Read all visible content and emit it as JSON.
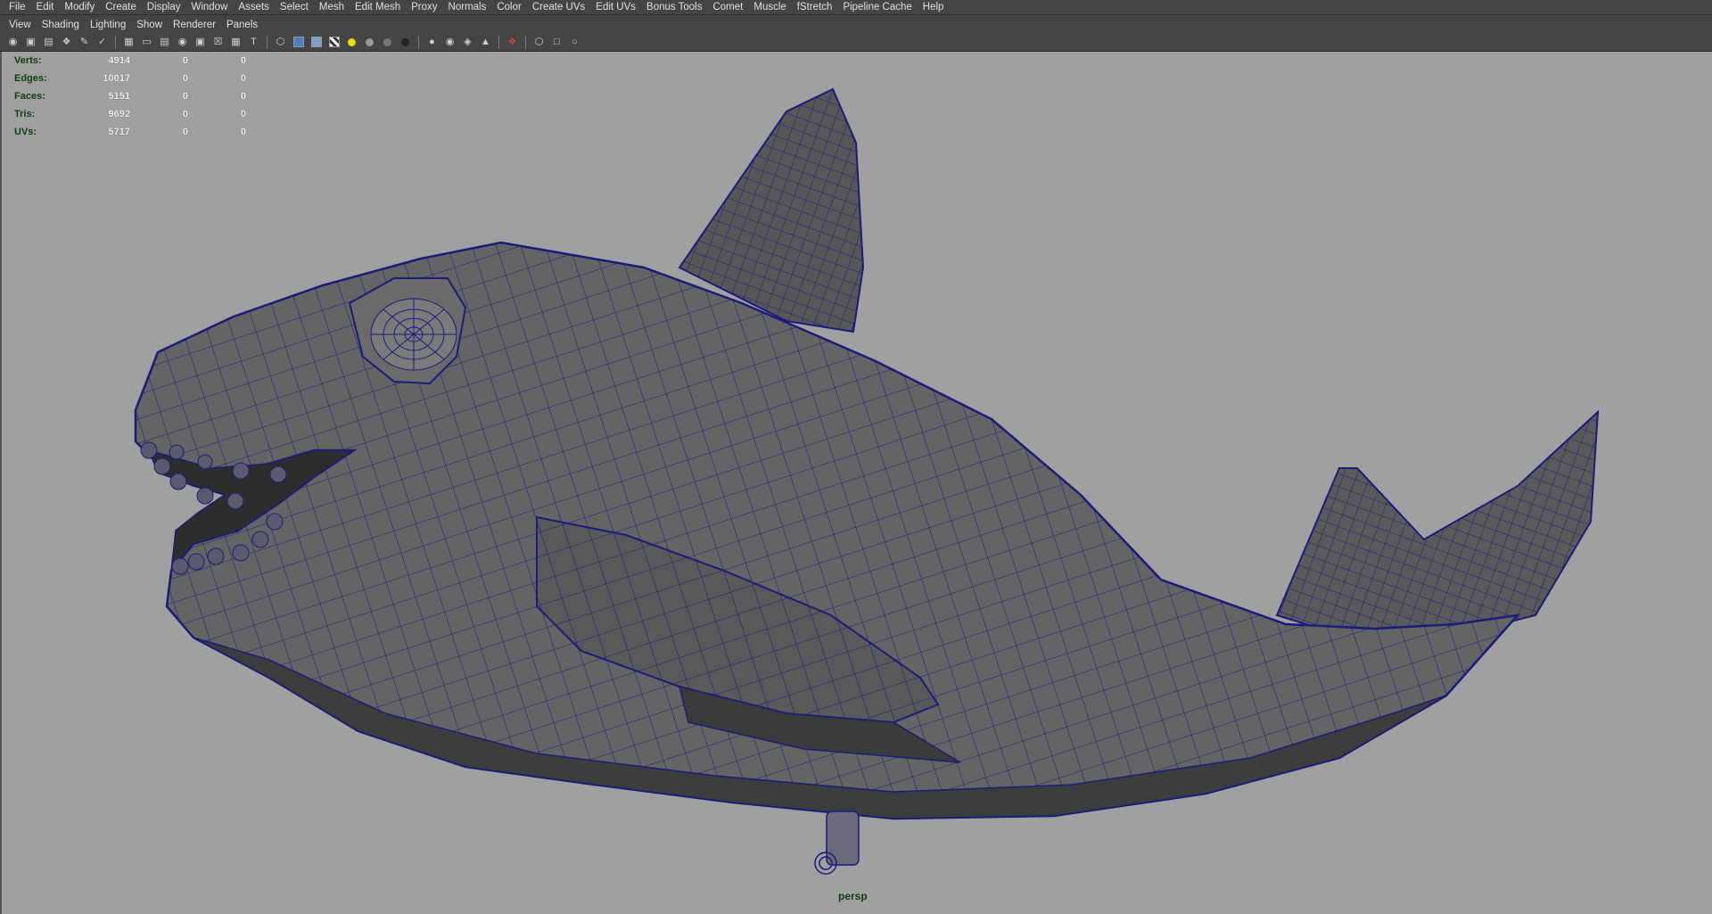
{
  "menu": {
    "items": [
      "File",
      "Edit",
      "Modify",
      "Create",
      "Display",
      "Window",
      "Assets",
      "Select",
      "Mesh",
      "Edit Mesh",
      "Proxy",
      "Normals",
      "Color",
      "Create UVs",
      "Edit UVs",
      "Bonus Tools",
      "Comet",
      "Muscle",
      "fStretch",
      "Pipeline Cache",
      "Help"
    ]
  },
  "panel_menu": {
    "items": [
      "View",
      "Shading",
      "Lighting",
      "Show",
      "Renderer",
      "Panels"
    ]
  },
  "hud": {
    "rows": [
      {
        "label": "Verts:",
        "value": "4914",
        "selected": "0",
        "component": "0"
      },
      {
        "label": "Edges:",
        "value": "10017",
        "selected": "0",
        "component": "0"
      },
      {
        "label": "Faces:",
        "value": "5151",
        "selected": "0",
        "component": "0"
      },
      {
        "label": "Tris:",
        "value": "9692",
        "selected": "0",
        "component": "0"
      },
      {
        "label": "UVs:",
        "value": "5717",
        "selected": "0",
        "component": "0"
      }
    ]
  },
  "viewport": {
    "camera": "persp",
    "background_color": "#a0a0a0",
    "wire_color": "#1b1b7a",
    "mesh_color": "#5e5e5e"
  },
  "toolbar_icons": [
    "camera-attributes-icon",
    "bookmark-icon",
    "image-plane-icon",
    "2d-pan-icon",
    "grease-pencil-icon",
    "camera-tools-icon",
    "grid-icon",
    "film-gate-icon",
    "resolution-gate-icon",
    "gate-mask-icon",
    "field-chart-icon",
    "safe-action-icon",
    "safe-title-icon",
    "wireframe-icon",
    "smooth-shade-icon",
    "wireframe-on-shaded-icon",
    "textured-icon",
    "use-lights-icon",
    "shadows-icon",
    "ambient-occlusion-icon",
    "anti-aliasing-icon",
    "xray-icon",
    "xray-joints-icon",
    "xray-components-icon",
    "backface-icon",
    "isolate-select-icon",
    "frame-all-icon",
    "frame-selected-icon",
    "pipeline-icon"
  ]
}
